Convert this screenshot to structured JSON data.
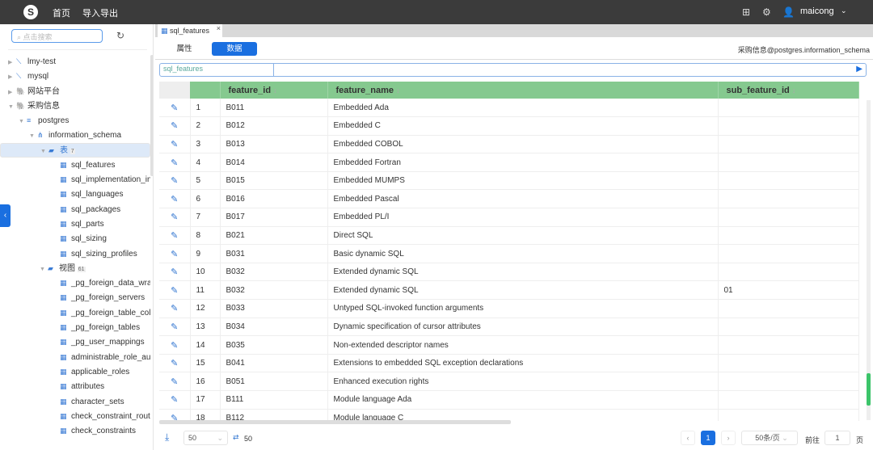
{
  "header": {
    "logo": "S",
    "nav": [
      "首页",
      "导入导出"
    ],
    "user": "maicong",
    "icons": [
      "translate-icon",
      "settings-icon",
      "user-icon"
    ]
  },
  "sidebar": {
    "search_placeholder": "点击搜索",
    "items": [
      {
        "label": "lmy-test",
        "level": 0,
        "arrow": "▶",
        "icon": "mysql-icon",
        "glyph": "⟍"
      },
      {
        "label": "mysql",
        "level": 0,
        "arrow": "▶",
        "icon": "mysql-icon",
        "glyph": "⟍"
      },
      {
        "label": "网站平台",
        "level": 0,
        "arrow": "▶",
        "icon": "postgres-icon",
        "glyph": "🐘"
      },
      {
        "label": "采购信息",
        "level": 0,
        "arrow": "▼",
        "icon": "postgres-icon",
        "glyph": "🐘"
      },
      {
        "label": "postgres",
        "level": 1,
        "arrow": "▼",
        "icon": "database-icon",
        "glyph": "≡"
      },
      {
        "label": "information_schema",
        "level": 2,
        "arrow": "▼",
        "icon": "schema-icon",
        "glyph": "⋔"
      },
      {
        "label": "表",
        "count": "7",
        "level": 3,
        "arrow": "▼",
        "icon": "folder-icon",
        "glyph": "▰",
        "selected": true
      },
      {
        "label": "sql_features",
        "level": 4,
        "icon": "table-icon",
        "glyph": "▦"
      },
      {
        "label": "sql_implementation_info",
        "level": 4,
        "icon": "table-icon",
        "glyph": "▦"
      },
      {
        "label": "sql_languages",
        "level": 4,
        "icon": "table-icon",
        "glyph": "▦"
      },
      {
        "label": "sql_packages",
        "level": 4,
        "icon": "table-icon",
        "glyph": "▦"
      },
      {
        "label": "sql_parts",
        "level": 4,
        "icon": "table-icon",
        "glyph": "▦"
      },
      {
        "label": "sql_sizing",
        "level": 4,
        "icon": "table-icon",
        "glyph": "▦"
      },
      {
        "label": "sql_sizing_profiles",
        "level": 4,
        "icon": "table-icon",
        "glyph": "▦"
      },
      {
        "label": "视图",
        "count": "61",
        "level": 3,
        "arrow": "▼",
        "icon": "folder-icon",
        "glyph": "▰"
      },
      {
        "label": "_pg_foreign_data_wrappers",
        "level": 4,
        "icon": "view-icon",
        "glyph": "▦"
      },
      {
        "label": "_pg_foreign_servers",
        "level": 4,
        "icon": "view-icon",
        "glyph": "▦"
      },
      {
        "label": "_pg_foreign_table_columns",
        "level": 4,
        "icon": "view-icon",
        "glyph": "▦"
      },
      {
        "label": "_pg_foreign_tables",
        "level": 4,
        "icon": "view-icon",
        "glyph": "▦"
      },
      {
        "label": "_pg_user_mappings",
        "level": 4,
        "icon": "view-icon",
        "glyph": "▦"
      },
      {
        "label": "administrable_role_authorizations",
        "level": 4,
        "icon": "view-icon",
        "glyph": "▦"
      },
      {
        "label": "applicable_roles",
        "level": 4,
        "icon": "view-icon",
        "glyph": "▦"
      },
      {
        "label": "attributes",
        "level": 4,
        "icon": "view-icon",
        "glyph": "▦"
      },
      {
        "label": "character_sets",
        "level": 4,
        "icon": "view-icon",
        "glyph": "▦"
      },
      {
        "label": "check_constraint_routine_usage",
        "level": 4,
        "icon": "view-icon",
        "glyph": "▦"
      },
      {
        "label": "check_constraints",
        "level": 4,
        "icon": "view-icon",
        "glyph": "▦"
      }
    ]
  },
  "tab": {
    "label": "sql_features",
    "close": "×"
  },
  "subtabs": {
    "props": "属性",
    "data": "数据"
  },
  "connection": "采购信息@postgres.information_schema",
  "query": {
    "table": "sql_features",
    "value": ""
  },
  "table": {
    "columns": [
      "feature_id",
      "feature_name",
      "sub_feature_id"
    ],
    "rows": [
      [
        "1",
        "B011",
        "Embedded Ada",
        ""
      ],
      [
        "2",
        "B012",
        "Embedded C",
        ""
      ],
      [
        "3",
        "B013",
        "Embedded COBOL",
        ""
      ],
      [
        "4",
        "B014",
        "Embedded Fortran",
        ""
      ],
      [
        "5",
        "B015",
        "Embedded MUMPS",
        ""
      ],
      [
        "6",
        "B016",
        "Embedded Pascal",
        ""
      ],
      [
        "7",
        "B017",
        "Embedded PL/I",
        ""
      ],
      [
        "8",
        "B021",
        "Direct SQL",
        ""
      ],
      [
        "9",
        "B031",
        "Basic dynamic SQL",
        ""
      ],
      [
        "10",
        "B032",
        "Extended dynamic SQL",
        ""
      ],
      [
        "11",
        "B032",
        "Extended dynamic SQL",
        "01"
      ],
      [
        "12",
        "B033",
        "Untyped SQL-invoked function arguments",
        ""
      ],
      [
        "13",
        "B034",
        "Dynamic specification of cursor attributes",
        ""
      ],
      [
        "14",
        "B035",
        "Non-extended descriptor names",
        ""
      ],
      [
        "15",
        "B041",
        "Extensions to embedded SQL exception declarations",
        ""
      ],
      [
        "16",
        "B051",
        "Enhanced execution rights",
        ""
      ],
      [
        "17",
        "B111",
        "Module language Ada",
        ""
      ],
      [
        "18",
        "B112",
        "Module language C",
        ""
      ]
    ]
  },
  "footer": {
    "limit": "50",
    "count": "50",
    "page": "1",
    "page_size": "50条/页",
    "goto_label": "前往",
    "goto_value": "1",
    "page_unit": "页"
  },
  "colors": {
    "accent": "#1a6fe0",
    "header_green": "#85c98f",
    "topbar": "#3b3b3b"
  }
}
